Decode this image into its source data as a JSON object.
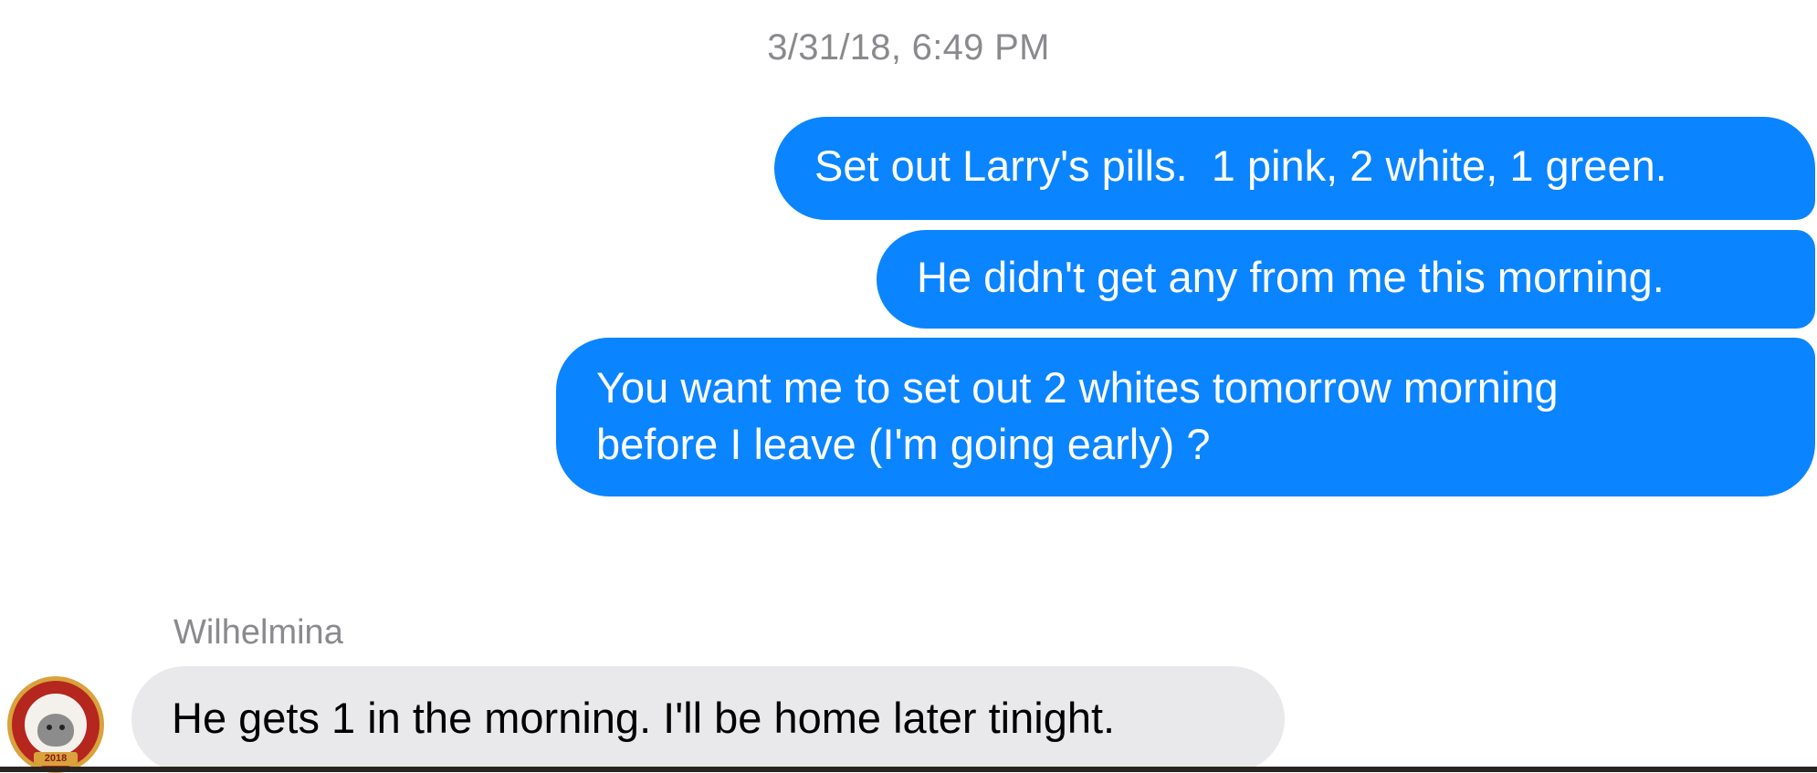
{
  "conversation": {
    "timestamp": "3/31/18, 6:49 PM",
    "outgoing": [
      {
        "text": "Set out Larry's pills.  1 pink, 2 white, 1 green."
      },
      {
        "text": "He didn't get any from me this morning."
      },
      {
        "text": "You want me to set out 2 whites tomorrow morning\nbefore I leave (I'm going early) ?"
      }
    ],
    "incoming": {
      "sender": "Wilhelmina",
      "avatar_badge": "2018",
      "text": "He gets 1 in the morning. I'll be home later tinight."
    }
  },
  "colors": {
    "outgoing_bubble": "#0b84ff",
    "incoming_bubble": "#e9e9eb",
    "meta_text": "#8a8a8e"
  }
}
